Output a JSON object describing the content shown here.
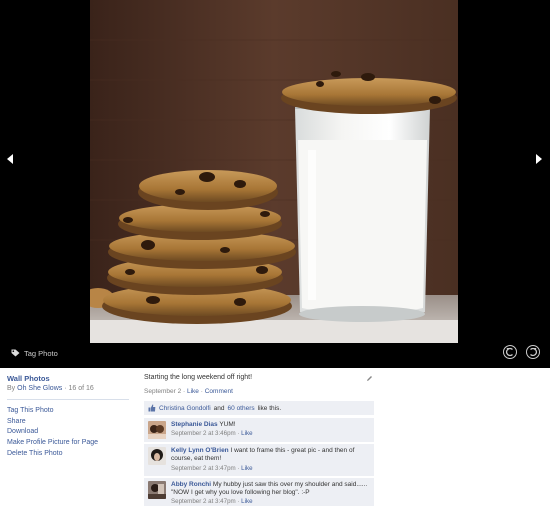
{
  "viewer": {
    "tag_photo_label": "Tag Photo"
  },
  "meta": {
    "album_title": "Wall Photos",
    "by_prefix": "By ",
    "author": "Oh She Glows",
    "position": " · 16 of 16",
    "actions": [
      "Tag This Photo",
      "Share",
      "Download",
      "Make Profile Picture for Page",
      "Delete This Photo"
    ]
  },
  "post": {
    "caption": "Starting the long weekend off right!",
    "date": "September 2",
    "sep1": " · ",
    "like": "Like",
    "sep2": " · ",
    "comment": "Comment"
  },
  "likes": {
    "first_name": "Christina Gondolfi",
    "and": "and",
    "others": "60 others",
    "suffix": "like this."
  },
  "comments": [
    {
      "author": "Stephanie Dias",
      "text": "YUM!",
      "time": "September 2 at 3:46pm",
      "like": "Like"
    },
    {
      "author": "Kelly Lynn O'Brien",
      "text": "I want to frame this - great pic - and then of course, eat them!",
      "time": "September 2 at 3:47pm",
      "like": "Like"
    },
    {
      "author": "Abby Ronchi",
      "text": "My hubby just saw this over my shoulder and said...... \"NOW I get why you love following her blog\". :-P",
      "time": "September 2 at 3:47pm",
      "like": "Like"
    }
  ],
  "colors": {
    "link": "#3b5998",
    "viewer_bg": "#000000",
    "comment_bg": "#edeff4",
    "muted": "#808080"
  },
  "icons": [
    "left-arrow-icon",
    "right-arrow-icon",
    "tag-icon",
    "rotate-left-icon",
    "rotate-right-icon",
    "pencil-icon",
    "thumbs-up-icon"
  ]
}
